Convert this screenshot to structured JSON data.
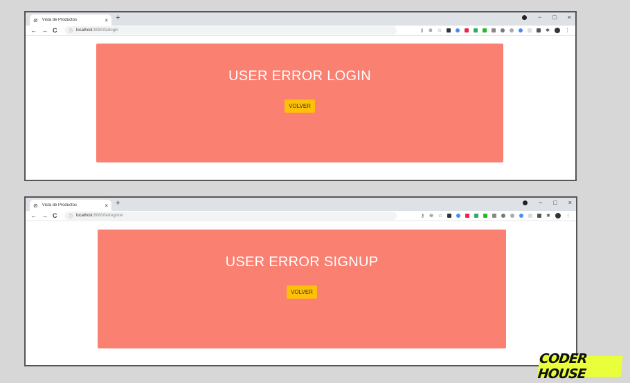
{
  "windows": [
    {
      "tab_title": "Vista de Productos",
      "url_host": "localhost",
      "url_path": ":8080/faillogin",
      "heading": "USER ERROR LOGIN",
      "button_label": "VOLVER"
    },
    {
      "tab_title": "Vista de Productos",
      "url_host": "localhost",
      "url_path": ":8080/failregister",
      "heading": "USER ERROR SIGNUP",
      "button_label": "VOLVER"
    }
  ],
  "brand": "CODER HOUSE",
  "colors": {
    "card": "#fa8072",
    "button": "#ffc107",
    "brand_bg": "#eaff3c"
  },
  "icons": {
    "back": "←",
    "forward": "→",
    "reload": "C",
    "info": "ⓘ",
    "close_tab": "×",
    "new_tab": "+",
    "minimize": "−",
    "maximize": "□",
    "close_window": "×",
    "menu": "⋮"
  }
}
